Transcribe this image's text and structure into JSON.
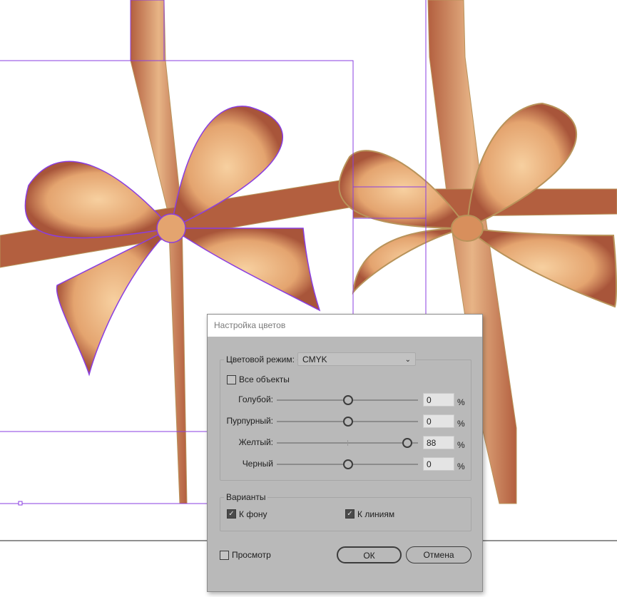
{
  "dialog": {
    "title": "Настройка цветов",
    "color_mode_label": "Цветовой режим:",
    "color_mode_value": "CMYK",
    "all_objects_label": "Все объекты",
    "all_objects_checked": false,
    "sliders": [
      {
        "label": "Голубой:",
        "value": "0",
        "unit": "%"
      },
      {
        "label": "Пурпурный:",
        "value": "0",
        "unit": "%"
      },
      {
        "label": "Желтый:",
        "value": "88",
        "unit": "%"
      },
      {
        "label": "Черный",
        "value": "0",
        "unit": "%"
      }
    ],
    "variants_label": "Варианты",
    "fill_label": "К фону",
    "fill_checked": true,
    "stroke_label": "К линиям",
    "stroke_checked": true,
    "preview_label": "Просмотр",
    "preview_checked": false,
    "ok_label": "ОК",
    "cancel_label": "Отмена"
  },
  "colors": {
    "ribbon": "#b35f3f",
    "bow_light": "#f2c595",
    "selection": "#8a3ee0"
  }
}
